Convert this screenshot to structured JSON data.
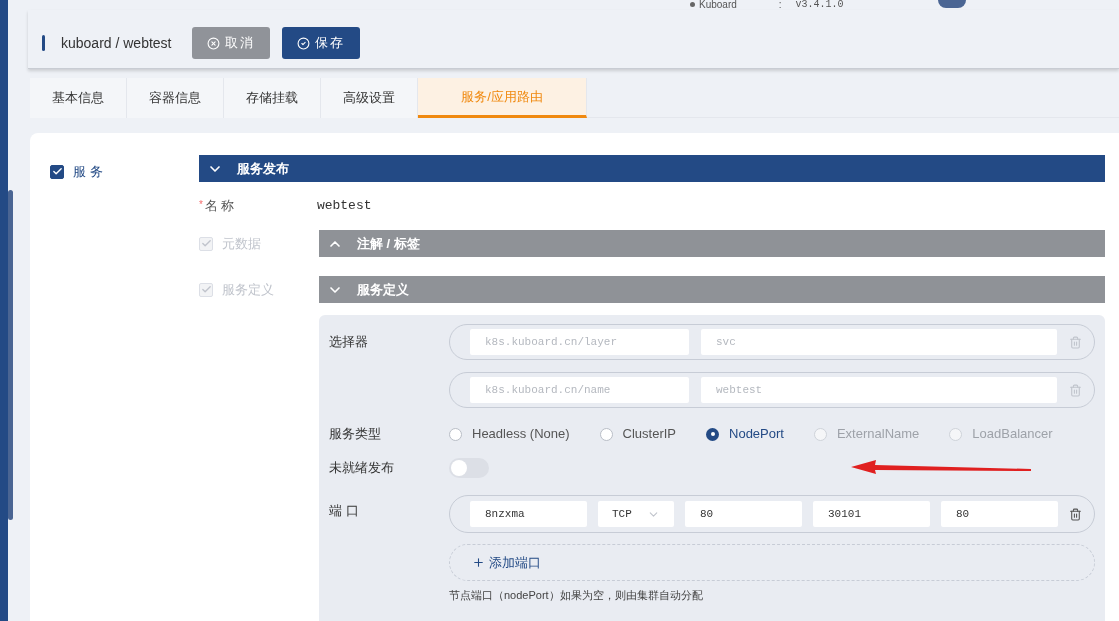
{
  "top_bar": {
    "product": "Kuboard",
    "separator": ":",
    "version": "v3.4.1.0"
  },
  "header": {
    "breadcrumb": "kuboard / webtest",
    "buttons": [
      {
        "label": "取消",
        "kind": "cancel"
      },
      {
        "label": "保存",
        "kind": "save"
      }
    ]
  },
  "tabs": [
    {
      "label": "基本信息",
      "selected": false
    },
    {
      "label": "容器信息",
      "selected": false
    },
    {
      "label": "存储挂载",
      "selected": false
    },
    {
      "label": "高级设置",
      "selected": false
    },
    {
      "label": "服务/应用路由",
      "selected": true
    }
  ],
  "service": {
    "label": "服务",
    "checked": true
  },
  "publish_section": {
    "title": "服务发布",
    "expanded": true
  },
  "name_field": {
    "label": "名称",
    "required_mark": "*",
    "value": "webtest"
  },
  "metadata": {
    "label": "元数据",
    "checked": true,
    "disabled": true,
    "section": {
      "title": "注解 / 标签",
      "expanded": false
    }
  },
  "definition": {
    "label": "服务定义",
    "checked": true,
    "disabled": true,
    "section": {
      "title": "服务定义",
      "expanded": true
    }
  },
  "selector": {
    "label": "选择器",
    "rows": [
      {
        "key": "k8s.kuboard.cn/layer",
        "value": "svc"
      },
      {
        "key": "k8s.kuboard.cn/name",
        "value": "webtest"
      }
    ]
  },
  "service_type": {
    "label": "服务类型",
    "options": [
      {
        "label": "Headless (None)",
        "selected": false,
        "disabled": false
      },
      {
        "label": "ClusterIP",
        "selected": false,
        "disabled": false
      },
      {
        "label": "NodePort",
        "selected": true,
        "disabled": false
      },
      {
        "label": "ExternalName",
        "selected": false,
        "disabled": true
      },
      {
        "label": "LoadBalancer",
        "selected": false,
        "disabled": true
      }
    ]
  },
  "unready_publish": {
    "label": "未就绪发布",
    "on": false
  },
  "ports": {
    "label": "端口",
    "rows": [
      {
        "name": "8nzxma",
        "protocol": "TCP",
        "port": "80",
        "node_port": "30101",
        "target_port": "80"
      }
    ],
    "add_label": "添加端口",
    "hint": "节点端口（nodePort）如果为空，则由集群自动分配"
  }
}
